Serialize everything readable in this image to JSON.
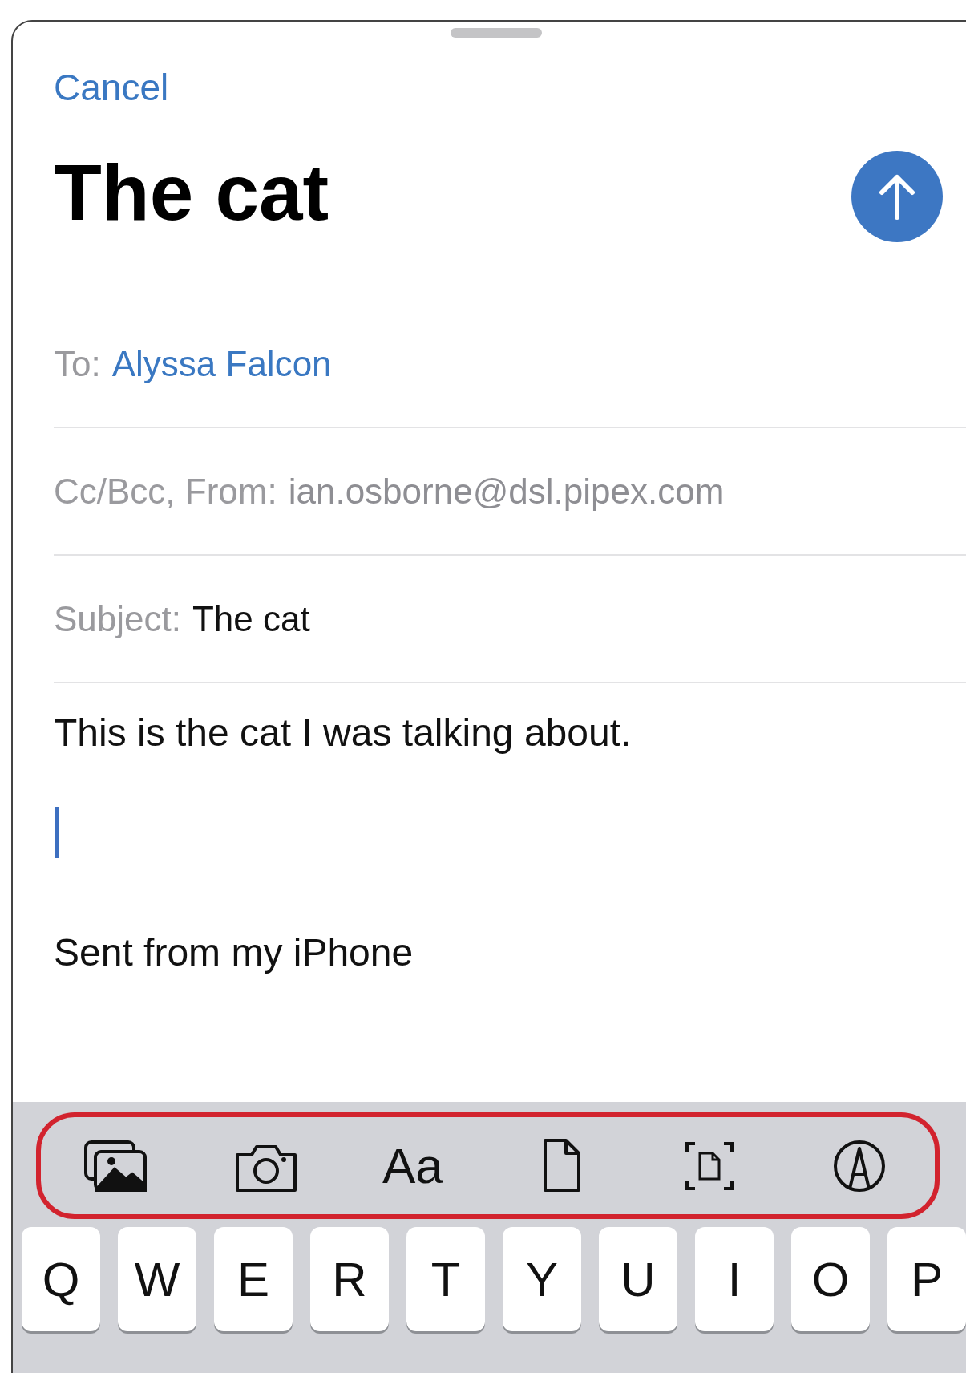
{
  "cancel": "Cancel",
  "title": "The cat",
  "fields": [
    {
      "label": "To:",
      "value": "Alyssa Falcon",
      "kind": "recipient"
    },
    {
      "label": "Cc/Bcc, From:",
      "value": "ian.osborne@dsl.pipex.com",
      "kind": "plain"
    },
    {
      "label": "Subject:",
      "value": "The cat",
      "kind": "subject"
    }
  ],
  "body": "This is the cat I was talking about.",
  "signature": "Sent from my iPhone",
  "toolbar": [
    {
      "kind": "photos"
    },
    {
      "kind": "camera"
    },
    {
      "kind": "text",
      "label": "Aa"
    },
    {
      "kind": "document"
    },
    {
      "kind": "scan"
    },
    {
      "kind": "markup"
    }
  ],
  "keys": [
    "Q",
    "W",
    "E",
    "R",
    "T",
    "Y",
    "U",
    "I",
    "O",
    "P"
  ]
}
